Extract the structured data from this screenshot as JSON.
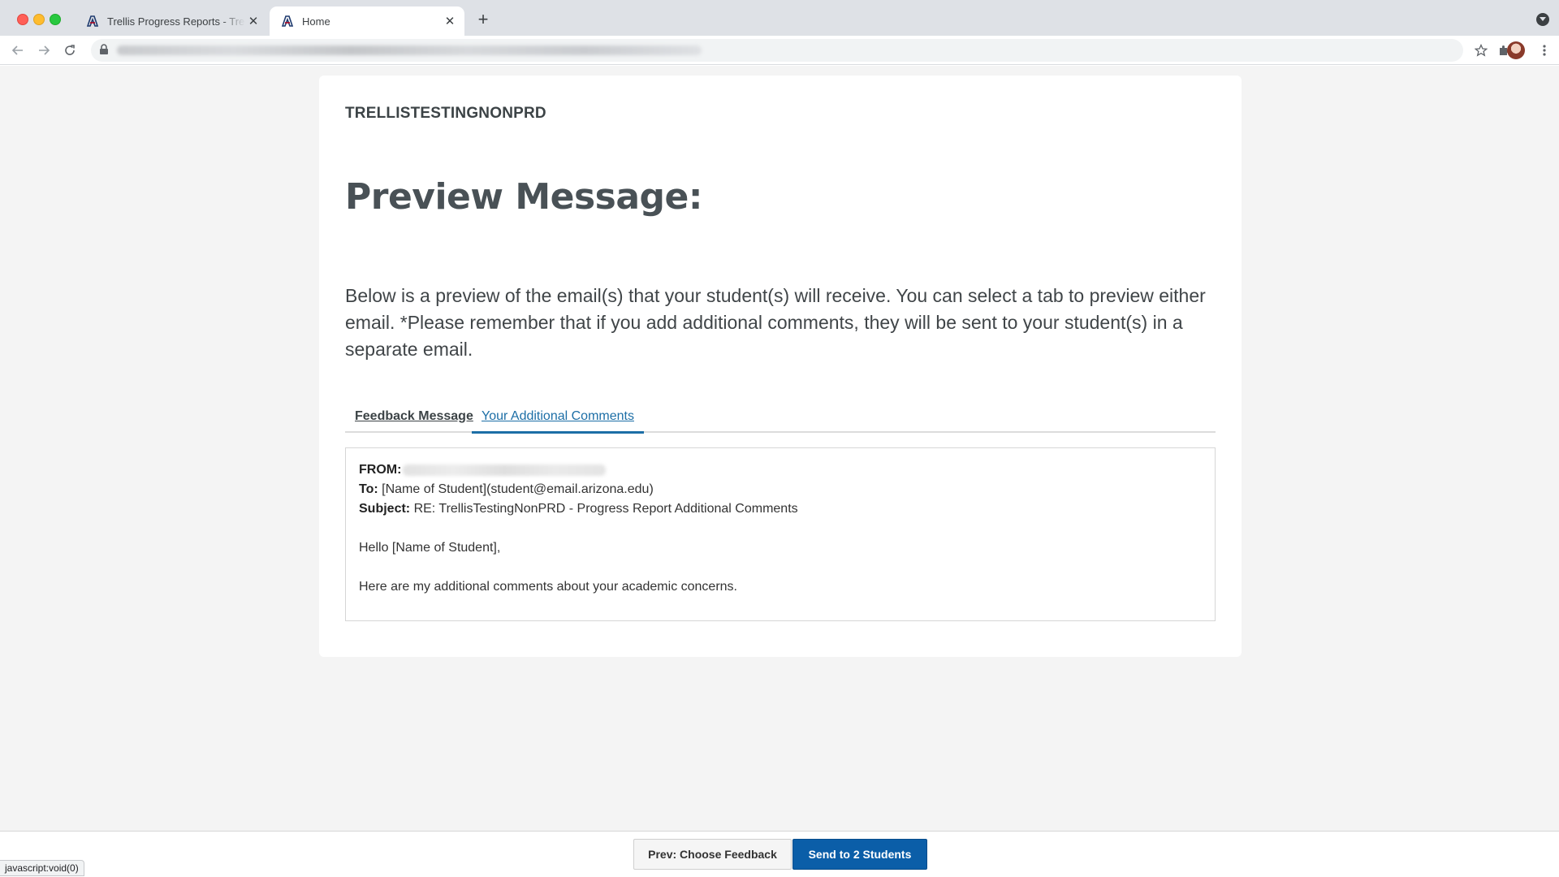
{
  "browser": {
    "tabs": [
      {
        "title": "Trellis Progress Reports - Trellis",
        "active": false
      },
      {
        "title": "Home",
        "active": true
      }
    ],
    "new_tab_symbol": "+",
    "close_symbol": "✕"
  },
  "page": {
    "org_name": "TRELLISTESTINGNONPRD",
    "title": "Preview Message:",
    "description": "Below is a preview of the email(s) that your student(s) will receive. You can select a tab to preview either email. *Please remember that if you add additional comments, they will be sent to your student(s) in a separate email.",
    "tabs": [
      {
        "label": "Feedback Message",
        "active": false
      },
      {
        "label": "Your Additional Comments",
        "active": true
      }
    ],
    "email": {
      "from_label": "FROM:",
      "to_label": "To:",
      "to_value": " [Name of Student](student@email.arizona.edu)",
      "subject_label": "Subject:",
      "subject_value": " RE: TrellisTestingNonPRD - Progress Report Additional Comments",
      "greeting": "Hello [Name of Student],",
      "body": "Here are my additional comments about your academic concerns."
    }
  },
  "footer": {
    "prev_button": "Prev: Choose Feedback",
    "send_button": "Send to 2 Students"
  },
  "status_bar": {
    "text": "javascript:void(0)"
  },
  "colors": {
    "primary": "#0b5ea8",
    "link": "#1c6ea6",
    "page_background": "#f4f4f4"
  }
}
